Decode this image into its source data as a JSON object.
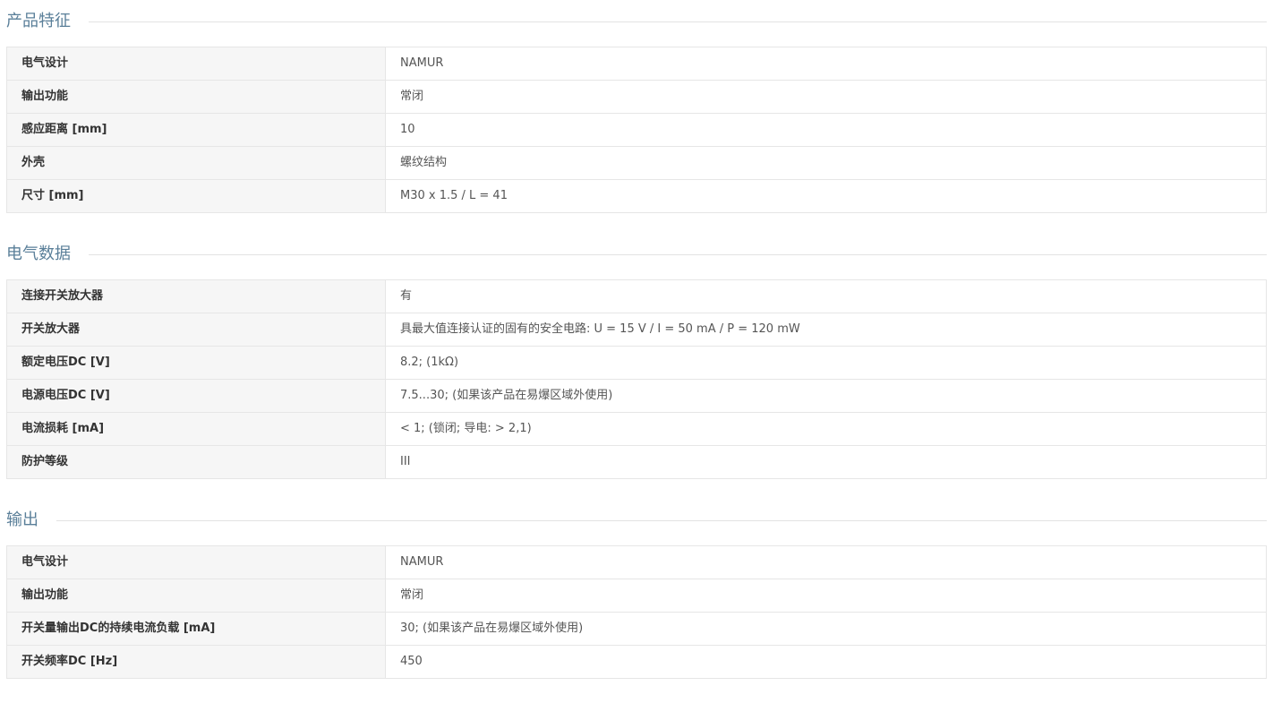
{
  "sections": [
    {
      "title": "产品特征",
      "rows": [
        {
          "label": "电气设计",
          "value": "NAMUR"
        },
        {
          "label": "输出功能",
          "value": "常闭"
        },
        {
          "label": "感应距离 [mm]",
          "value": "10"
        },
        {
          "label": "外壳",
          "value": "螺纹结构"
        },
        {
          "label": "尺寸 [mm]",
          "value": "M30 x 1.5 / L = 41"
        }
      ]
    },
    {
      "title": "电气数据",
      "rows": [
        {
          "label": "连接开关放大器",
          "value": "有"
        },
        {
          "label": "开关放大器",
          "value": "具最大值连接认证的固有的安全电路: U = 15 V / I = 50 mA / P = 120 mW"
        },
        {
          "label": "额定电压DC [V]",
          "value": "8.2; (1kΩ)"
        },
        {
          "label": "电源电压DC [V]",
          "value": "7.5...30; (如果该产品在易爆区域外使用)"
        },
        {
          "label": "电流损耗 [mA]",
          "value": "< 1; (锁闭; 导电: > 2,1)"
        },
        {
          "label": "防护等级",
          "value": "III"
        }
      ]
    },
    {
      "title": "输出",
      "rows": [
        {
          "label": "电气设计",
          "value": "NAMUR"
        },
        {
          "label": "输出功能",
          "value": "常闭"
        },
        {
          "label": "开关量输出DC的持续电流负载 [mA]",
          "value": "30; (如果该产品在易爆区域外使用)"
        },
        {
          "label": "开关频率DC [Hz]",
          "value": "450"
        }
      ]
    }
  ]
}
